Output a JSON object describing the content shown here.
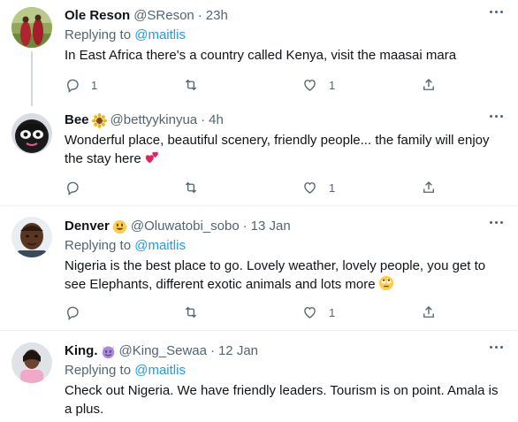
{
  "replying_to_prefix": "Replying to",
  "tweets": [
    {
      "name": "Ole Reson",
      "handle": "@SReson",
      "separator": "·",
      "time": "23h",
      "replying_to": "@maitlis",
      "text": "In East Africa there's a country called Kenya, visit the maasai mara",
      "reply_count": "1",
      "like_count": "1"
    },
    {
      "name": "Bee",
      "name_emoji": "sunflower",
      "handle": "@bettyykinyua",
      "separator": "·",
      "time": "4h",
      "text": "Wonderful place, beautiful scenery, friendly people... the family will enjoy the stay here",
      "text_emoji": "two-hearts",
      "reply_count": "",
      "like_count": "1"
    },
    {
      "name": "Denver",
      "name_emoji": "smiley-face",
      "handle": "@Oluwatobi_sobo",
      "separator": "·",
      "time": "13 Jan",
      "replying_to": "@maitlis",
      "text": "Nigeria is the best place to go. Lovely weather, lovely people, you get to see Elephants, different exotic animals and lots more",
      "text_emoji": "rolling-eyes-face",
      "reply_count": "",
      "like_count": "1"
    },
    {
      "name": "King.",
      "name_emoji": "smiling-devil",
      "handle": "@King_Sewaa",
      "separator": "·",
      "time": "12 Jan",
      "replying_to": "@maitlis",
      "text": "Check out Nigeria. We have friendly leaders. Tourism is on point. Amala is a plus."
    }
  ],
  "colors": {
    "link": "#1d9bf0",
    "secondary_text": "#536471",
    "primary_text": "#0f1419",
    "divider": "#eff3f4"
  }
}
